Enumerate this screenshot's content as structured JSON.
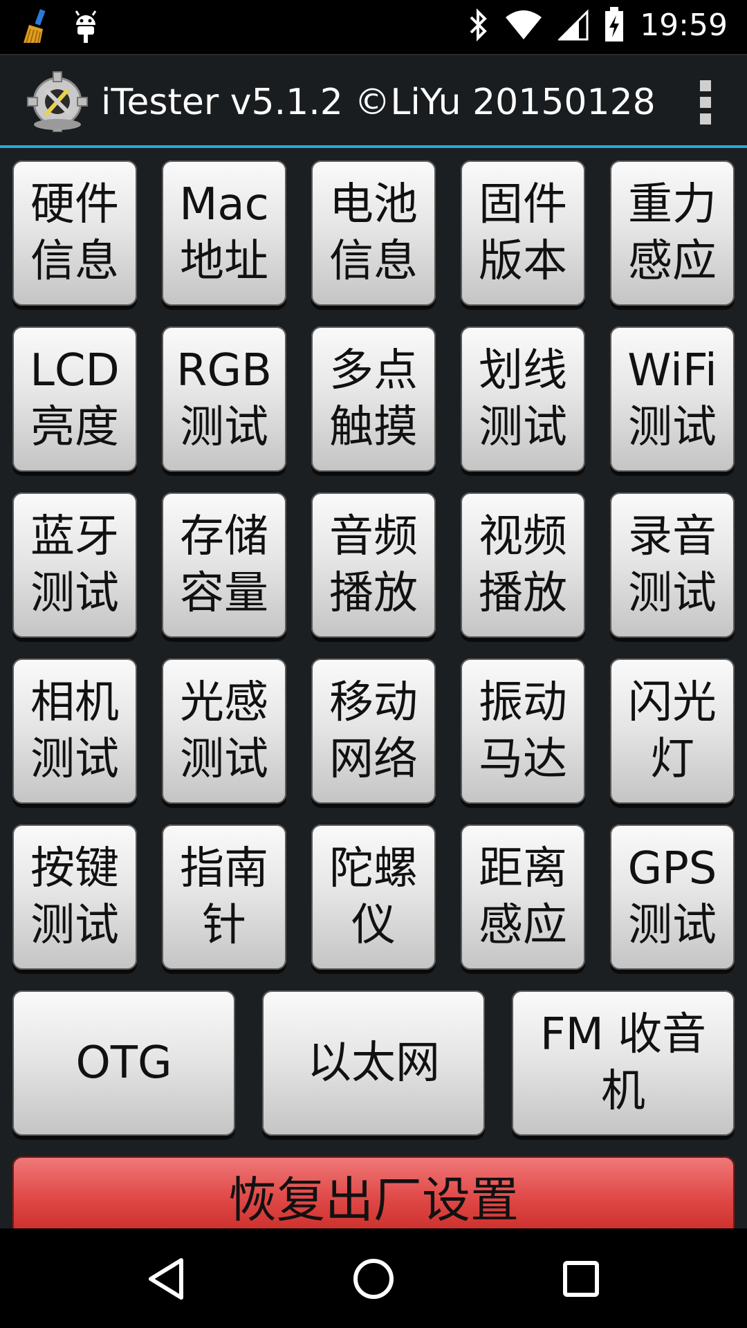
{
  "status_bar": {
    "time": "19:59",
    "left_icons": [
      "broom-icon",
      "android-debug-icon"
    ],
    "right_icons": [
      "bluetooth-icon",
      "wifi-icon",
      "signal-icon",
      "battery-charging-icon"
    ]
  },
  "action_bar": {
    "title": "iTester v5.1.2 ©LiYu 20150128",
    "icon": "gear-tools-icon",
    "menu_icon": "overflow-menu-icon",
    "accent_color": "#29a7dd"
  },
  "grid": [
    {
      "label": "硬件\n信息"
    },
    {
      "label": "Mac\n地址"
    },
    {
      "label": "电池\n信息"
    },
    {
      "label": "固件\n版本"
    },
    {
      "label": "重力\n感应"
    },
    {
      "label": "LCD\n亮度"
    },
    {
      "label": "RGB\n测试"
    },
    {
      "label": "多点\n触摸"
    },
    {
      "label": "划线\n测试"
    },
    {
      "label": "WiFi\n测试"
    },
    {
      "label": "蓝牙\n测试"
    },
    {
      "label": "存储\n容量"
    },
    {
      "label": "音频\n播放"
    },
    {
      "label": "视频\n播放"
    },
    {
      "label": "录音\n测试"
    },
    {
      "label": "相机\n测试"
    },
    {
      "label": "光感\n测试"
    },
    {
      "label": "移动\n网络"
    },
    {
      "label": "振动\n马达"
    },
    {
      "label": "闪光\n灯"
    },
    {
      "label": "按键\n测试"
    },
    {
      "label": "指南\n针"
    },
    {
      "label": "陀螺\n仪"
    },
    {
      "label": "距离\n感应"
    },
    {
      "label": "GPS\n测试"
    }
  ],
  "wide_buttons": [
    {
      "label": "OTG"
    },
    {
      "label": "以太网"
    },
    {
      "label": "FM 收音\n机"
    }
  ],
  "reset_button": {
    "label": "恢复出厂设置",
    "color": "#e04a48"
  },
  "nav_bar": {
    "icons": [
      "back-icon",
      "home-icon",
      "recents-icon"
    ]
  }
}
